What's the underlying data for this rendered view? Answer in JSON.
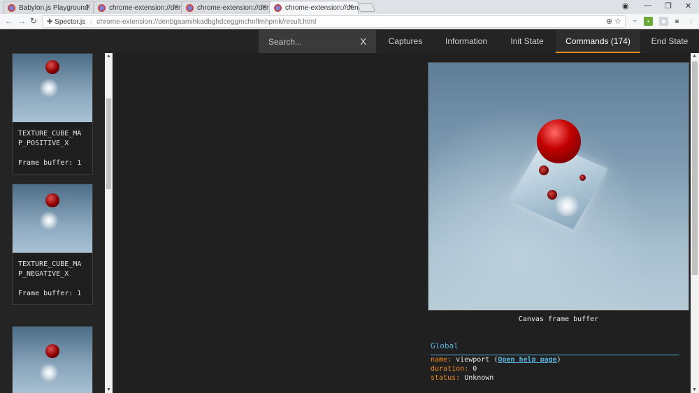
{
  "browser": {
    "tabs": [
      {
        "title": "Babylon.js Playground",
        "active": false
      },
      {
        "title": "chrome-extension://denb",
        "active": false
      },
      {
        "title": "chrome-extension://denb",
        "active": false
      },
      {
        "title": "chrome-extension://denb",
        "active": true
      }
    ],
    "address": {
      "site": "Spector.js",
      "url": "chrome-extension://denbgaamihkadbghdceggmchnflmhpmk/result.html"
    }
  },
  "spector": {
    "search_placeholder": "Search...",
    "search_clear": "X",
    "tabs": [
      {
        "label": "Captures",
        "active": false
      },
      {
        "label": "Information",
        "active": false
      },
      {
        "label": "Init State",
        "active": false
      },
      {
        "label": "Commands (174)",
        "active": true
      },
      {
        "label": "End State",
        "active": false
      }
    ],
    "accent_color": "#f28b1e",
    "link_color": "#5ab4e0"
  },
  "thumbnails": [
    {
      "name": "TEXTURE_CUBE_MAP_POSITIVE_X",
      "name_line1": "TEXTURE_CUBE_MA",
      "name_line2": "P_POSITIVE_X",
      "framebuffer": "Frame buffer: 1"
    },
    {
      "name": "TEXTURE_CUBE_MAP_NEGATIVE_X",
      "name_line1": "TEXTURE_CUBE_MA",
      "name_line2": "P_NEGATIVE_X",
      "framebuffer": "Frame buffer: 1"
    },
    {
      "name": "",
      "name_line1": "",
      "name_line2": "",
      "framebuffer": ""
    }
  ],
  "preview": {
    "caption": "Canvas frame buffer"
  },
  "global": {
    "title": "Global",
    "name_key": "name:",
    "name_value": "viewport",
    "help_link": "Open help page",
    "duration_key": "duration:",
    "duration_value": "0",
    "status_key": "status:",
    "status_value": "Unknown"
  }
}
